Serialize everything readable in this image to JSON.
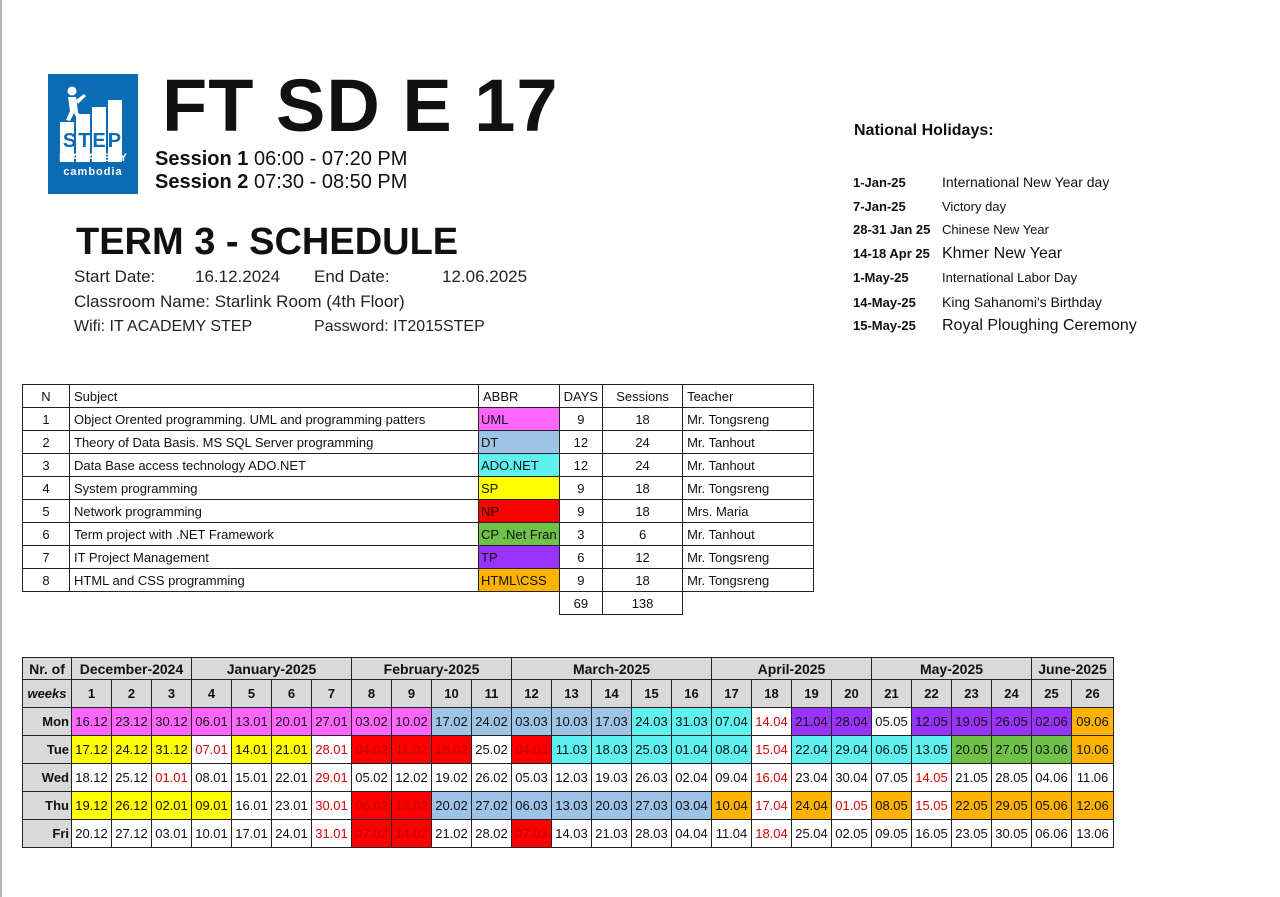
{
  "logo": {
    "brand": "STEP",
    "line1": "IT ACADEMY",
    "line2": "cambodia"
  },
  "header": {
    "title": "FT SD E 17",
    "sessions": [
      {
        "label": "Session 1",
        "time": "06:00 - 07:20 PM"
      },
      {
        "label": "Session 2",
        "time": "07:30 - 08:50 PM"
      }
    ]
  },
  "term": {
    "title": "TERM 3 - SCHEDULE",
    "start_label": "Start Date:",
    "start_date": "16.12.2024",
    "end_label": "End Date:",
    "end_date": "12.06.2025",
    "classroom": "Classroom Name: Starlink Room (4th Floor)",
    "wifi": "Wifi: IT ACADEMY STEP",
    "password": "Password: IT2015STEP"
  },
  "holidays": {
    "title": "National Holidays:",
    "items": [
      {
        "date": "1-Jan-25",
        "name": "International New Year day"
      },
      {
        "date": "7-Jan-25",
        "name": "Victory day"
      },
      {
        "date": "28-31 Jan 25",
        "name": "Chinese New Year"
      },
      {
        "date": "14-18 Apr 25",
        "name": "Khmer New Year"
      },
      {
        "date": "1-May-25",
        "name": "International Labor Day"
      },
      {
        "date": "14-May-25",
        "name": "King Sahanomi's Birthday"
      },
      {
        "date": "15-May-25",
        "name": "Royal Ploughing Ceremony"
      }
    ]
  },
  "subjects": {
    "headers": [
      "N",
      "Subject",
      "ABBR",
      "DAYS",
      "Sessions",
      "Teacher"
    ],
    "rows": [
      {
        "n": "1",
        "subject": "Object Orented programming. UML and programming patters",
        "abbr": "UML",
        "color": "#ff66ff",
        "days": "9",
        "sessions": "18",
        "teacher": "Mr. Tongsreng"
      },
      {
        "n": "2",
        "subject": "Theory of Data Basis. MS SQL Server programming",
        "abbr": "DT",
        "color": "#9dc3e6",
        "days": "12",
        "sessions": "24",
        "teacher": "Mr. Tanhout"
      },
      {
        "n": "3",
        "subject": "Data Base access technology ADO.NET",
        "abbr": "ADO.NET",
        "color": "#5ff0f0",
        "days": "12",
        "sessions": "24",
        "teacher": "Mr. Tanhout"
      },
      {
        "n": "4",
        "subject": "System programming",
        "abbr": "SP",
        "color": "#ffff00",
        "days": "9",
        "sessions": "18",
        "teacher": "Mr. Tongsreng"
      },
      {
        "n": "5",
        "subject": "Network programming",
        "abbr": "NP",
        "color": "#ff0000",
        "days": "9",
        "sessions": "18",
        "teacher": "Mrs. Maria"
      },
      {
        "n": "6",
        "subject": "Term project with .NET Framework",
        "abbr": "CP .Net Fran",
        "color": "#70c14a",
        "days": "3",
        "sessions": "6",
        "teacher": "Mr. Tanhout"
      },
      {
        "n": "7",
        "subject": "IT Project Management",
        "abbr": "TP",
        "color": "#9933ff",
        "days": "6",
        "sessions": "12",
        "teacher": "Mr. Tongsreng"
      },
      {
        "n": "8",
        "subject": "HTML and CSS programming",
        "abbr": "HTML\\CSS",
        "color": "#ffb300",
        "days": "9",
        "sessions": "18",
        "teacher": "Mr. Tongsreng"
      }
    ],
    "total_days": "69",
    "total_sessions": "138"
  },
  "calendar": {
    "corner": "Nr. of",
    "weeks_label": "weeks",
    "months": [
      {
        "name": "December-2024",
        "span": 3
      },
      {
        "name": "January-2025",
        "span": 4
      },
      {
        "name": "February-2025",
        "span": 4
      },
      {
        "name": "March-2025",
        "span": 5
      },
      {
        "name": "April-2025",
        "span": 4
      },
      {
        "name": "May-2025",
        "span": 4
      },
      {
        "name": "June-2025",
        "span": 2
      }
    ],
    "weeks": [
      "1",
      "2",
      "3",
      "4",
      "5",
      "6",
      "7",
      "8",
      "9",
      "10",
      "11",
      "12",
      "13",
      "14",
      "15",
      "16",
      "17",
      "18",
      "19",
      "20",
      "21",
      "22",
      "23",
      "24",
      "25",
      "26"
    ],
    "legend": {
      "U": "#ff66ff",
      "D": "#9dc3e6",
      "A": "#5ff0f0",
      "S": "#ffff00",
      "N": "#ff0000",
      "C": "#70c14a",
      "T": "#9933ff",
      "H": "#ffb300",
      "R": "#ffffff",
      "-": "#ffffff"
    },
    "days": [
      {
        "name": "Mon",
        "dates": [
          "16.12",
          "23.12",
          "30.12",
          "06.01",
          "13.01",
          "20.01",
          "27.01",
          "03.02",
          "10.02",
          "17.02",
          "24.02",
          "03.03",
          "10.03",
          "17.03",
          "24.03",
          "31.03",
          "07.04",
          "14.04",
          "21.04",
          "28.04",
          "05.05",
          "12.05",
          "19.05",
          "26.05",
          "02.06",
          "09.06"
        ],
        "codes": [
          "U",
          "U",
          "U",
          "U",
          "U",
          "U",
          "U",
          "U",
          "U",
          "D",
          "D",
          "D",
          "D",
          "D",
          "A",
          "A",
          "A",
          "R",
          "T",
          "T",
          "-",
          "T",
          "T",
          "T",
          "T",
          "H"
        ]
      },
      {
        "name": "Tue",
        "dates": [
          "17.12",
          "24.12",
          "31.12",
          "07.01",
          "14.01",
          "21.01",
          "28.01",
          "04.02",
          "11.02",
          "18.02",
          "25.02",
          "04.03",
          "11.03",
          "18.03",
          "25.03",
          "01.04",
          "08.04",
          "15.04",
          "22.04",
          "29.04",
          "06.05",
          "13.05",
          "20.05",
          "27.05",
          "03.06",
          "10.06"
        ],
        "codes": [
          "S",
          "S",
          "S",
          "R",
          "S",
          "S",
          "R",
          "N",
          "N",
          "N",
          "-",
          "N",
          "A",
          "A",
          "A",
          "A",
          "A",
          "R",
          "A",
          "A",
          "A",
          "A",
          "C",
          "C",
          "C",
          "H"
        ]
      },
      {
        "name": "Wed",
        "dates": [
          "18.12",
          "25.12",
          "01.01",
          "08.01",
          "15.01",
          "22.01",
          "29.01",
          "05.02",
          "12.02",
          "19.02",
          "26.02",
          "05.03",
          "12.03",
          "19.03",
          "26.03",
          "02.04",
          "09.04",
          "16.04",
          "23.04",
          "30.04",
          "07.05",
          "14.05",
          "21.05",
          "28.05",
          "04.06",
          "11.06"
        ],
        "codes": [
          "-",
          "-",
          "R",
          "-",
          "-",
          "-",
          "R",
          "-",
          "-",
          "-",
          "-",
          "-",
          "-",
          "-",
          "-",
          "-",
          "-",
          "R",
          "-",
          "-",
          "-",
          "R",
          "-",
          "-",
          "-",
          "-"
        ]
      },
      {
        "name": "Thu",
        "dates": [
          "19.12",
          "26.12",
          "02.01",
          "09.01",
          "16.01",
          "23.01",
          "30.01",
          "06.02",
          "13.02",
          "20.02",
          "27.02",
          "06.03",
          "13.03",
          "20.03",
          "27.03",
          "03.04",
          "10.04",
          "17.04",
          "24.04",
          "01.05",
          "08.05",
          "15.05",
          "22.05",
          "29.05",
          "05.06",
          "12.06"
        ],
        "codes": [
          "S",
          "S",
          "S",
          "S",
          "-",
          "-",
          "R",
          "N",
          "N",
          "D",
          "D",
          "D",
          "D",
          "D",
          "D",
          "D",
          "H",
          "R",
          "H",
          "R",
          "H",
          "R",
          "H",
          "H",
          "H",
          "H"
        ]
      },
      {
        "name": "Fri",
        "dates": [
          "20.12",
          "27.12",
          "03.01",
          "10.01",
          "17.01",
          "24.01",
          "31.01",
          "07.02",
          "14.02",
          "21.02",
          "28.02",
          "07.03",
          "14.03",
          "21.03",
          "28.03",
          "04.04",
          "11.04",
          "18.04",
          "25.04",
          "02.05",
          "09.05",
          "16.05",
          "23.05",
          "30.05",
          "06.06",
          "13.06"
        ],
        "codes": [
          "-",
          "-",
          "-",
          "-",
          "-",
          "-",
          "R",
          "N",
          "N",
          "-",
          "-",
          "N",
          "-",
          "-",
          "-",
          "-",
          "-",
          "R",
          "-",
          "-",
          "-",
          "-",
          "-",
          "-",
          "-",
          "-"
        ]
      }
    ]
  }
}
